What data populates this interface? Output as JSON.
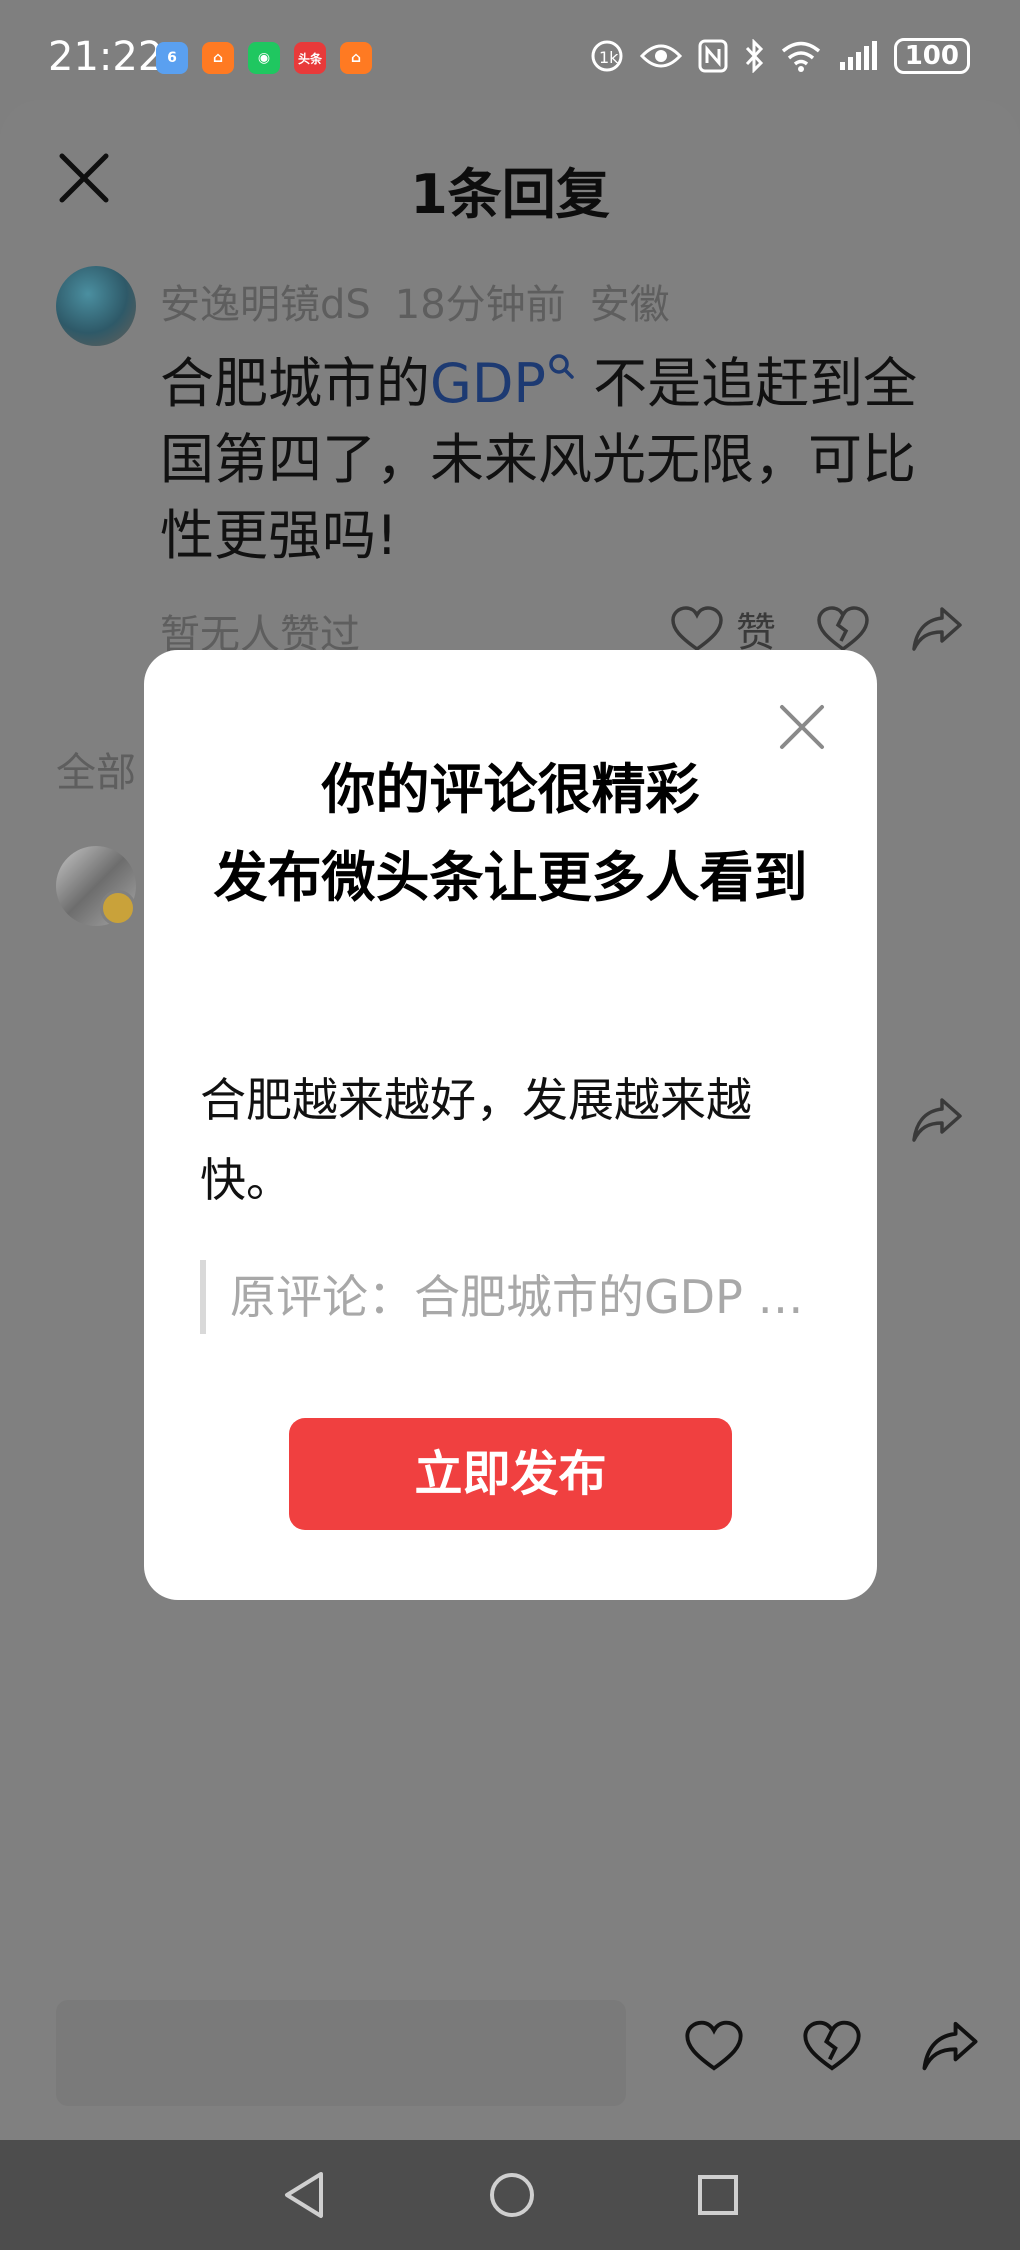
{
  "status_bar": {
    "time": "21:22",
    "app_icons": [
      {
        "name": "app-6",
        "label": "6",
        "color": "#5aa0f0"
      },
      {
        "name": "app-orange-1",
        "label": "",
        "color": "#ff7a22"
      },
      {
        "name": "wechat",
        "label": "",
        "color": "#1fc760"
      },
      {
        "name": "toutiao",
        "label": "头条",
        "color": "#e83a3a"
      },
      {
        "name": "app-orange-2",
        "label": "",
        "color": "#ff7a22"
      }
    ],
    "battery": "100"
  },
  "sheet": {
    "title": "1条回复",
    "comment": {
      "author": "安逸明镜dS",
      "time": "18分钟前",
      "location": "安徽",
      "text_before": "合肥城市的",
      "link": "GDP",
      "text_after": " 不是追赶到全国第四了，未来风光无限，可比性更强吗!",
      "no_likes": "暂无人赞过",
      "like_label": "赞"
    },
    "all_label": "全部"
  },
  "modal": {
    "title_line1": "你的评论很精彩",
    "title_line2": "发布微头条让更多人看到",
    "body": "合肥越来越好，发展越来越快。",
    "original": "原评论：合肥城市的GDP 不是追赶到全国第四了，未来风光无限，可比性更强吗!",
    "publish_label": "立即发布"
  },
  "colors": {
    "accent": "#f04040",
    "link": "#1d3a72",
    "overlay": "#7f7f7f"
  }
}
